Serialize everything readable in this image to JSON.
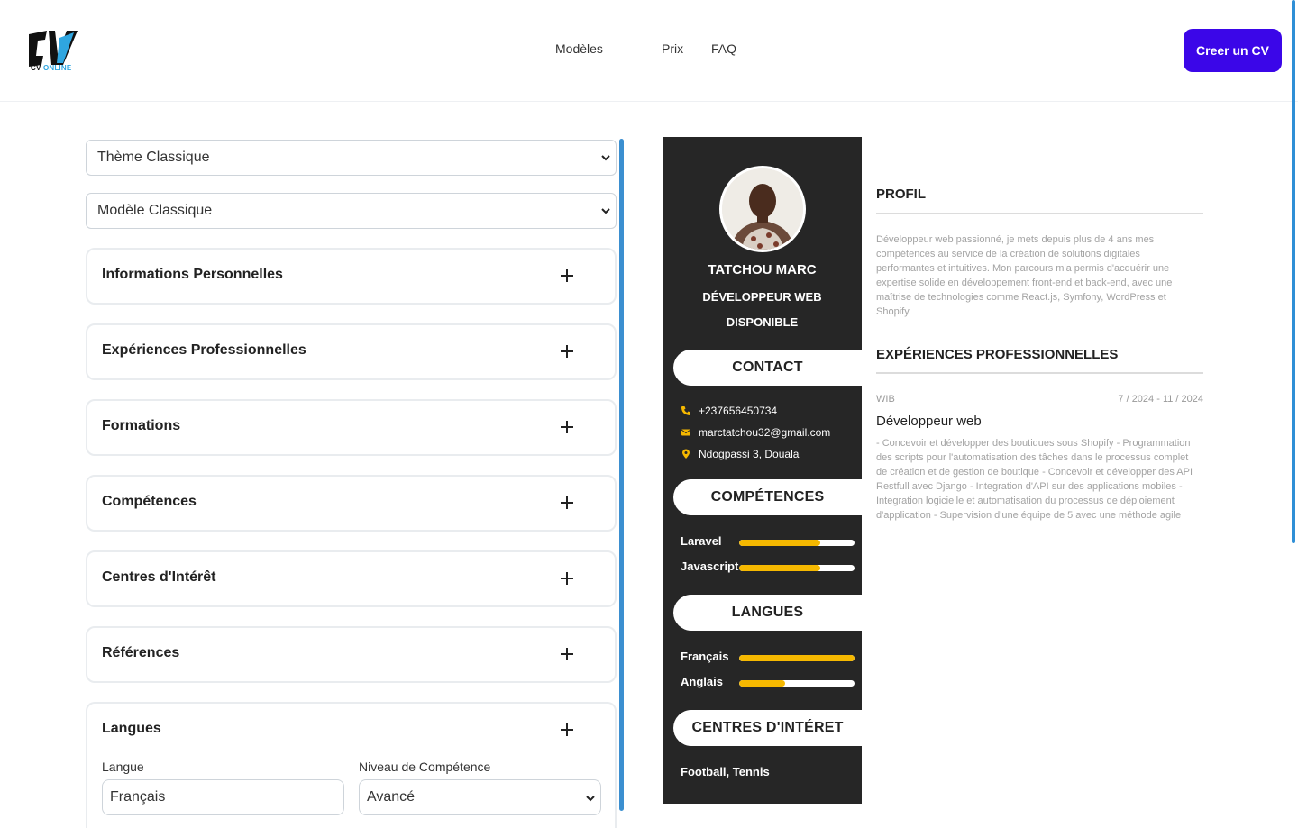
{
  "header": {
    "logo_text": "CV",
    "logo_sub": "CV ONLINE",
    "nav": [
      {
        "label": "Modèles"
      },
      {
        "label": "Prix"
      },
      {
        "label": "FAQ"
      }
    ],
    "cta_label": "Creer un CV",
    "accent": "#3b06e8"
  },
  "editor": {
    "theme_select": "Thème Classique",
    "model_select": "Modèle Classique",
    "sections": [
      {
        "label": "Informations Personnelles"
      },
      {
        "label": "Expériences Professionnelles"
      },
      {
        "label": "Formations"
      },
      {
        "label": "Compétences"
      },
      {
        "label": "Centres d'Intérêt"
      },
      {
        "label": "Références"
      },
      {
        "label": "Langues"
      }
    ],
    "langues_form": {
      "lang_label": "Langue",
      "lang_value": "Français",
      "level_label": "Niveau de Compétence",
      "level_value": "Avancé"
    }
  },
  "cv": {
    "name": "TATCHOU MARC",
    "job": "DÉVELOPPEUR WEB",
    "status": "DISPONIBLE",
    "contact_title": "CONTACT",
    "phone": "+237656450734",
    "email": "marctatchou32@gmail.com",
    "address": "Ndogpassi 3, Douala",
    "skills_title": "COMPÉTENCES",
    "skills": [
      {
        "label": "Laravel",
        "level": 0.7
      },
      {
        "label": "Javascript",
        "level": 0.7
      }
    ],
    "languages_title": "LANGUES",
    "languages": [
      {
        "label": "Français",
        "level": 1.0
      },
      {
        "label": "Anglais",
        "level": 0.4
      }
    ],
    "interests_title": "CENTRES D'INTÉRET",
    "interests": "Football, Tennis",
    "profile_title": "PROFIL",
    "profile_text": "Développeur web passionné, je mets depuis plus de 4 ans mes compétences au service de la création de solutions digitales performantes et intuitives. Mon parcours m'a permis d'acquérir une expertise solide en développement front-end et back-end, avec une maîtrise de technologies comme React.js, Symfony, WordPress et Shopify.",
    "experience_title": "EXPÉRIENCES PROFESSIONNELLES",
    "experience": {
      "company": "WIB",
      "dates": "7 / 2024 - 11 / 2024",
      "role": "Développeur web",
      "description": "- Concevoir et développer des boutiques sous Shopify - Programmation des scripts pour l'automatisation des tâches dans le processus complet de création et de gestion de boutique - Concevoir et développer des API Restfull avec Django - Integration d'API sur des applications mobiles - Integration logicielle et automatisation du processus de déploiement d'application - Supervision d'une équipe de 5 avec une méthode agile"
    },
    "bar_color": "#f5b800",
    "sidebar_color": "#262626"
  }
}
